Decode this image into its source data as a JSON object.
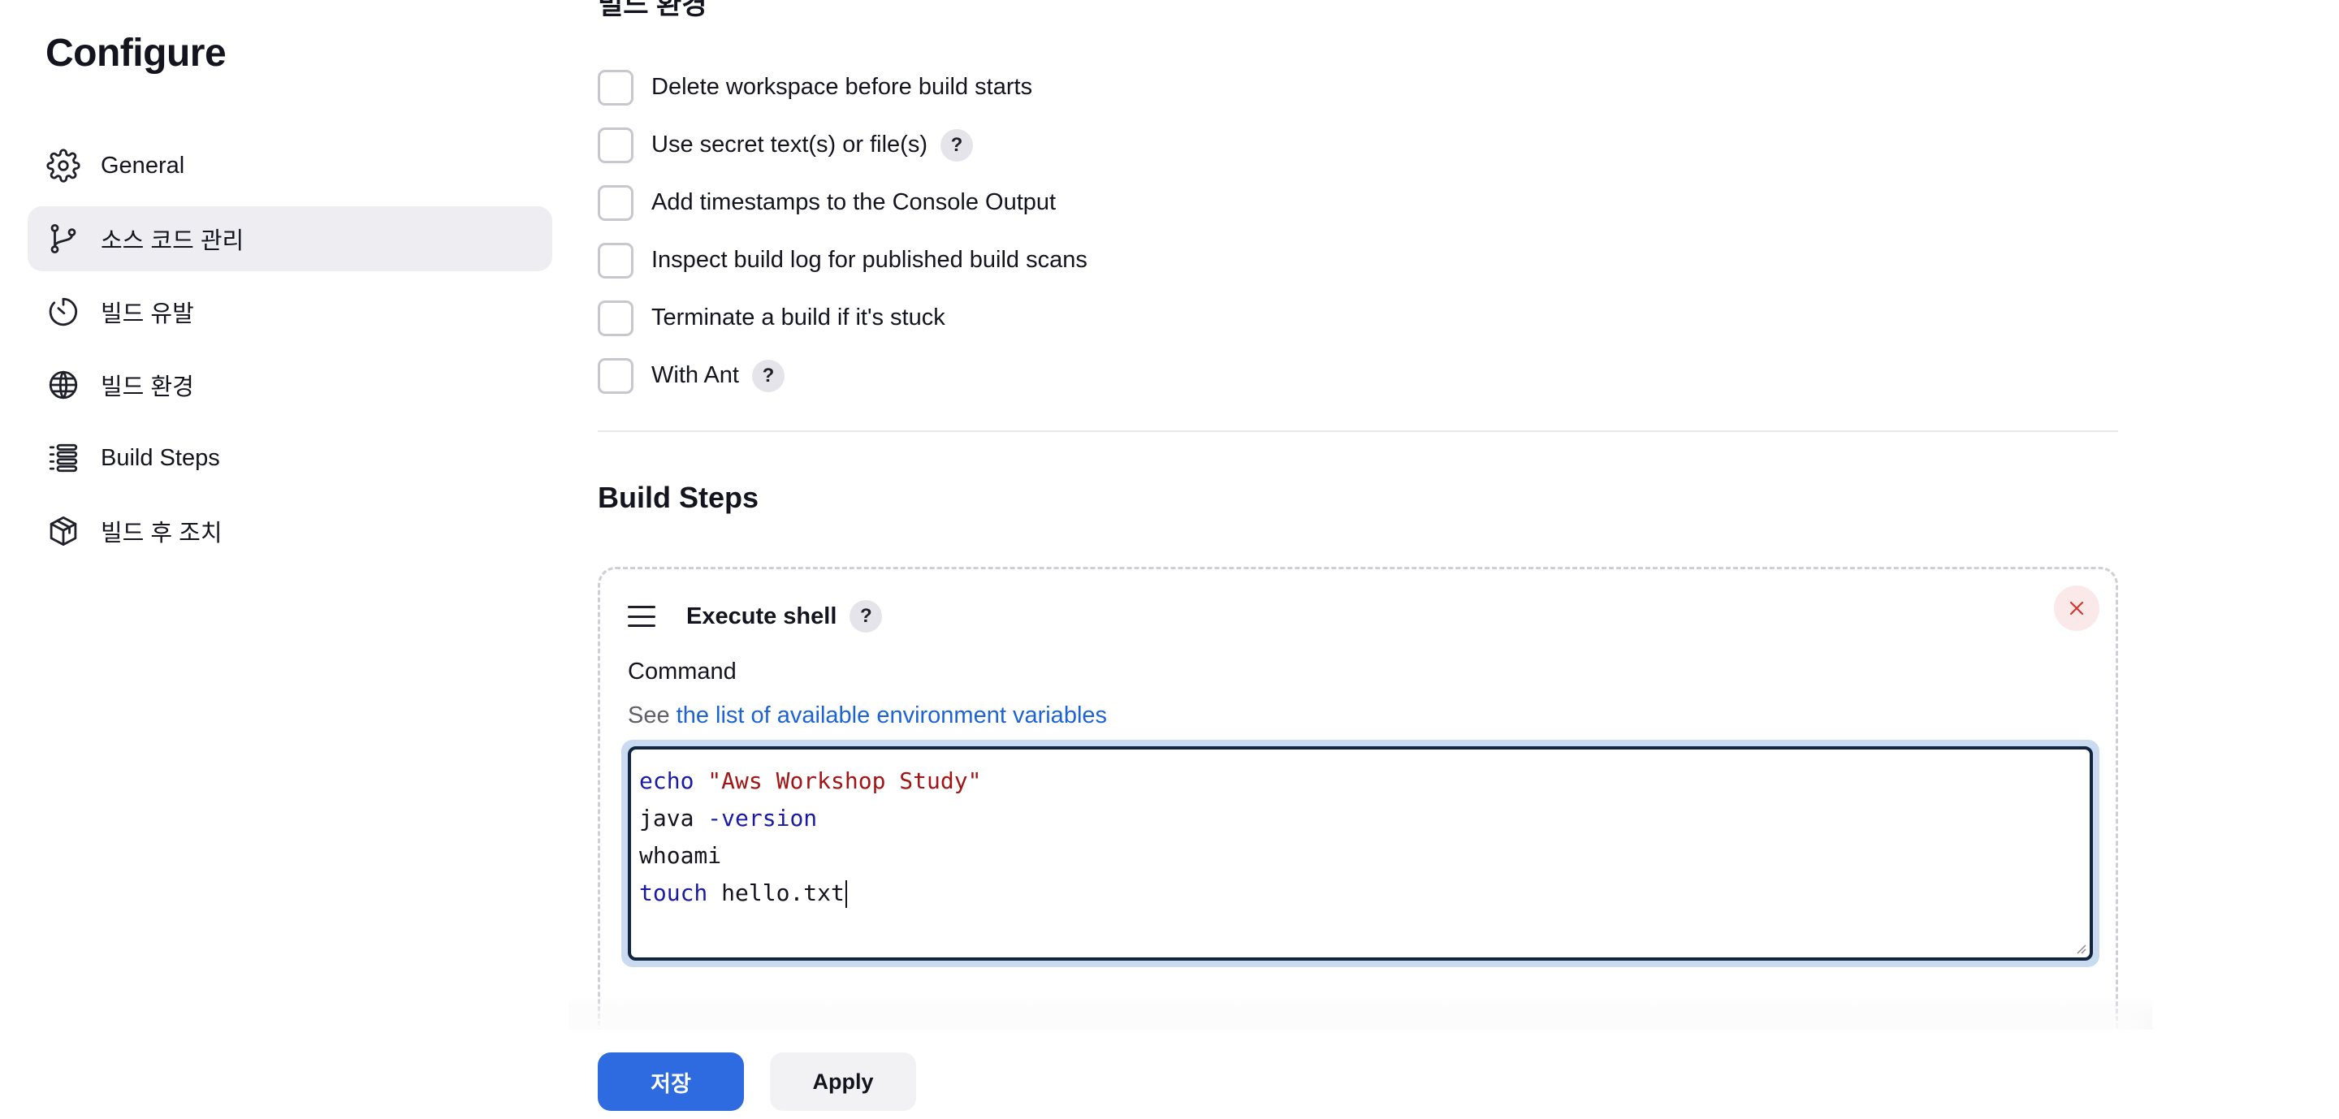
{
  "sidebar": {
    "title": "Configure",
    "items": [
      {
        "label": "General",
        "icon": "gear-icon"
      },
      {
        "label": "소스 코드 관리",
        "icon": "branch-icon",
        "active": true
      },
      {
        "label": "빌드 유발",
        "icon": "timer-icon"
      },
      {
        "label": "빌드 환경",
        "icon": "globe-icon"
      },
      {
        "label": "Build Steps",
        "icon": "list-icon"
      },
      {
        "label": "빌드 후 조치",
        "icon": "package-icon"
      }
    ]
  },
  "main": {
    "section_top_cut": "빌드 환경",
    "options": [
      {
        "label": "Delete workspace before build starts",
        "help": false
      },
      {
        "label": "Use secret text(s) or file(s)",
        "help": true
      },
      {
        "label": "Add timestamps to the Console Output",
        "help": false
      },
      {
        "label": "Inspect build log for published build scans",
        "help": false
      },
      {
        "label": "Terminate a build if it's stuck",
        "help": false
      },
      {
        "label": "With Ant",
        "help": true
      }
    ],
    "help_glyph": "?",
    "build_steps": {
      "title": "Build Steps",
      "step": {
        "title": "Execute shell",
        "command_label": "Command",
        "see_prefix": "See",
        "env_link": "the list of available environment variables",
        "lines": [
          {
            "kw": "echo",
            "rest": " ",
            "str": "\"Aws Workshop Study\""
          },
          {
            "plain": "java ",
            "kw": "-version"
          },
          {
            "plain": "whoami"
          },
          {
            "kw": "touch",
            "rest": " hello.txt"
          }
        ]
      }
    }
  },
  "footer": {
    "save_label": "저장",
    "apply_label": "Apply"
  },
  "colors": {
    "primary": "#2e6be0",
    "link": "#1d63d8",
    "keyword": "#1a1aa6",
    "string": "#a31515",
    "active_bg": "#ededf2"
  }
}
